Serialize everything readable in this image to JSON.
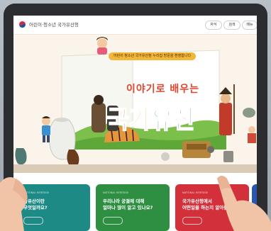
{
  "header": {
    "site_title": "어린이·청소년 국가유산청",
    "nav": [
      "자식",
      "검색",
      "메뉴"
    ]
  },
  "hero": {
    "banner": "어린이 청소년 국가유산청 누리집 방문을 환영합니다",
    "subtitle": "이야기로 배우는",
    "title_chars": [
      "국",
      "가",
      "유",
      "산"
    ]
  },
  "cards": [
    {
      "tag": "NATIONAL HERITAGE",
      "text_line1": "가유산이란",
      "text_line2": "무엇일까요?",
      "color": "#1d8a86"
    },
    {
      "tag": "NATIONAL HERITAGE",
      "text_line1": "우리나라 궁궐에 대해",
      "text_line2": "얼마나 많이 알고 있나요?",
      "color": "#2e8f43"
    },
    {
      "tag": "NATIONAL HERITAGE",
      "text_line1": "국가유산청에서",
      "text_line2": "어떤일을 하는지 알아볼까요?",
      "color": "#d2303a"
    }
  ],
  "colors": {
    "tablet": "#2b2d31",
    "page_bg": "#fbf4ea",
    "banner": "#f4b63a",
    "subtitle": "#e0462e"
  }
}
